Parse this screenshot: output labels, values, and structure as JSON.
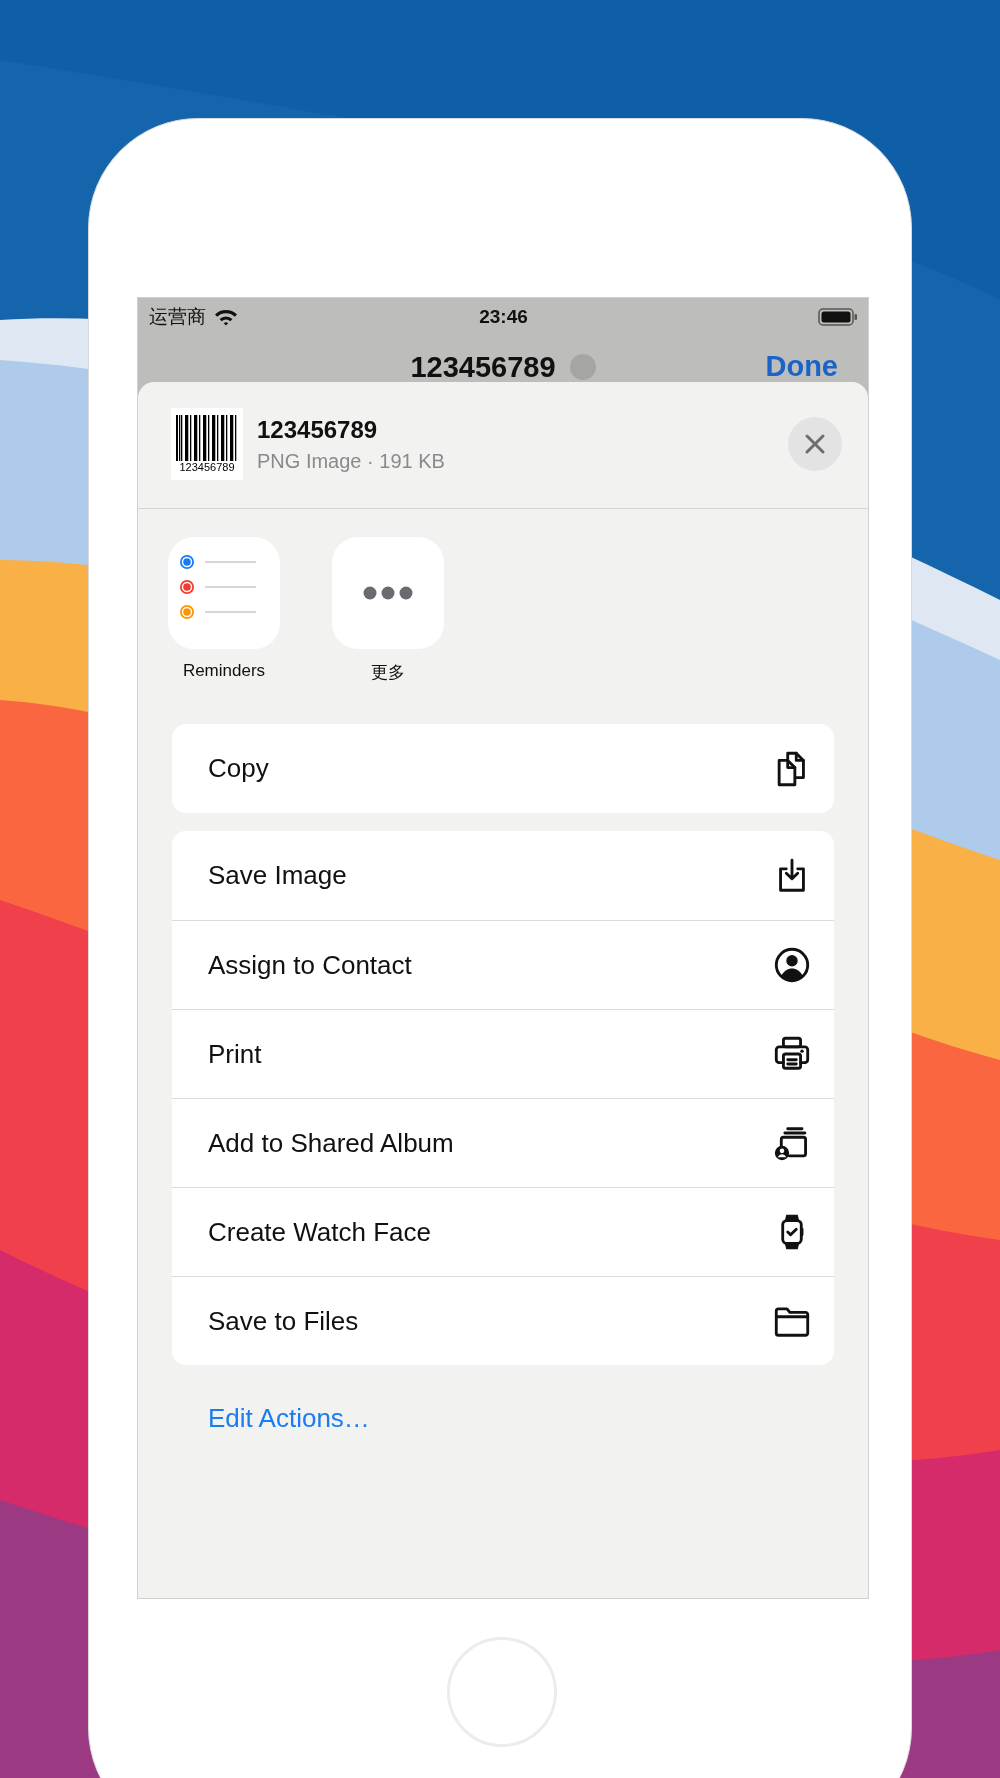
{
  "status_bar": {
    "carrier": "运营商",
    "time": "23:46"
  },
  "nav_bar": {
    "title": "123456789",
    "done": "Done"
  },
  "share_sheet": {
    "title": "123456789",
    "subtitle": "PNG Image · 191 KB",
    "thumbnail_caption": "123456789",
    "apps": [
      {
        "label": "Reminders",
        "kind": "reminders"
      },
      {
        "label": "更多",
        "kind": "more"
      }
    ],
    "action_groups": [
      [
        {
          "label": "Copy",
          "kind": "copy"
        }
      ],
      [
        {
          "label": "Save Image",
          "kind": "save"
        },
        {
          "label": "Assign to Contact",
          "kind": "contact"
        },
        {
          "label": "Print",
          "kind": "print"
        },
        {
          "label": "Add to Shared Album",
          "kind": "album"
        },
        {
          "label": "Create Watch Face",
          "kind": "watch"
        },
        {
          "label": "Save to Files",
          "kind": "folder"
        }
      ]
    ],
    "edit_actions": "Edit Actions…"
  }
}
